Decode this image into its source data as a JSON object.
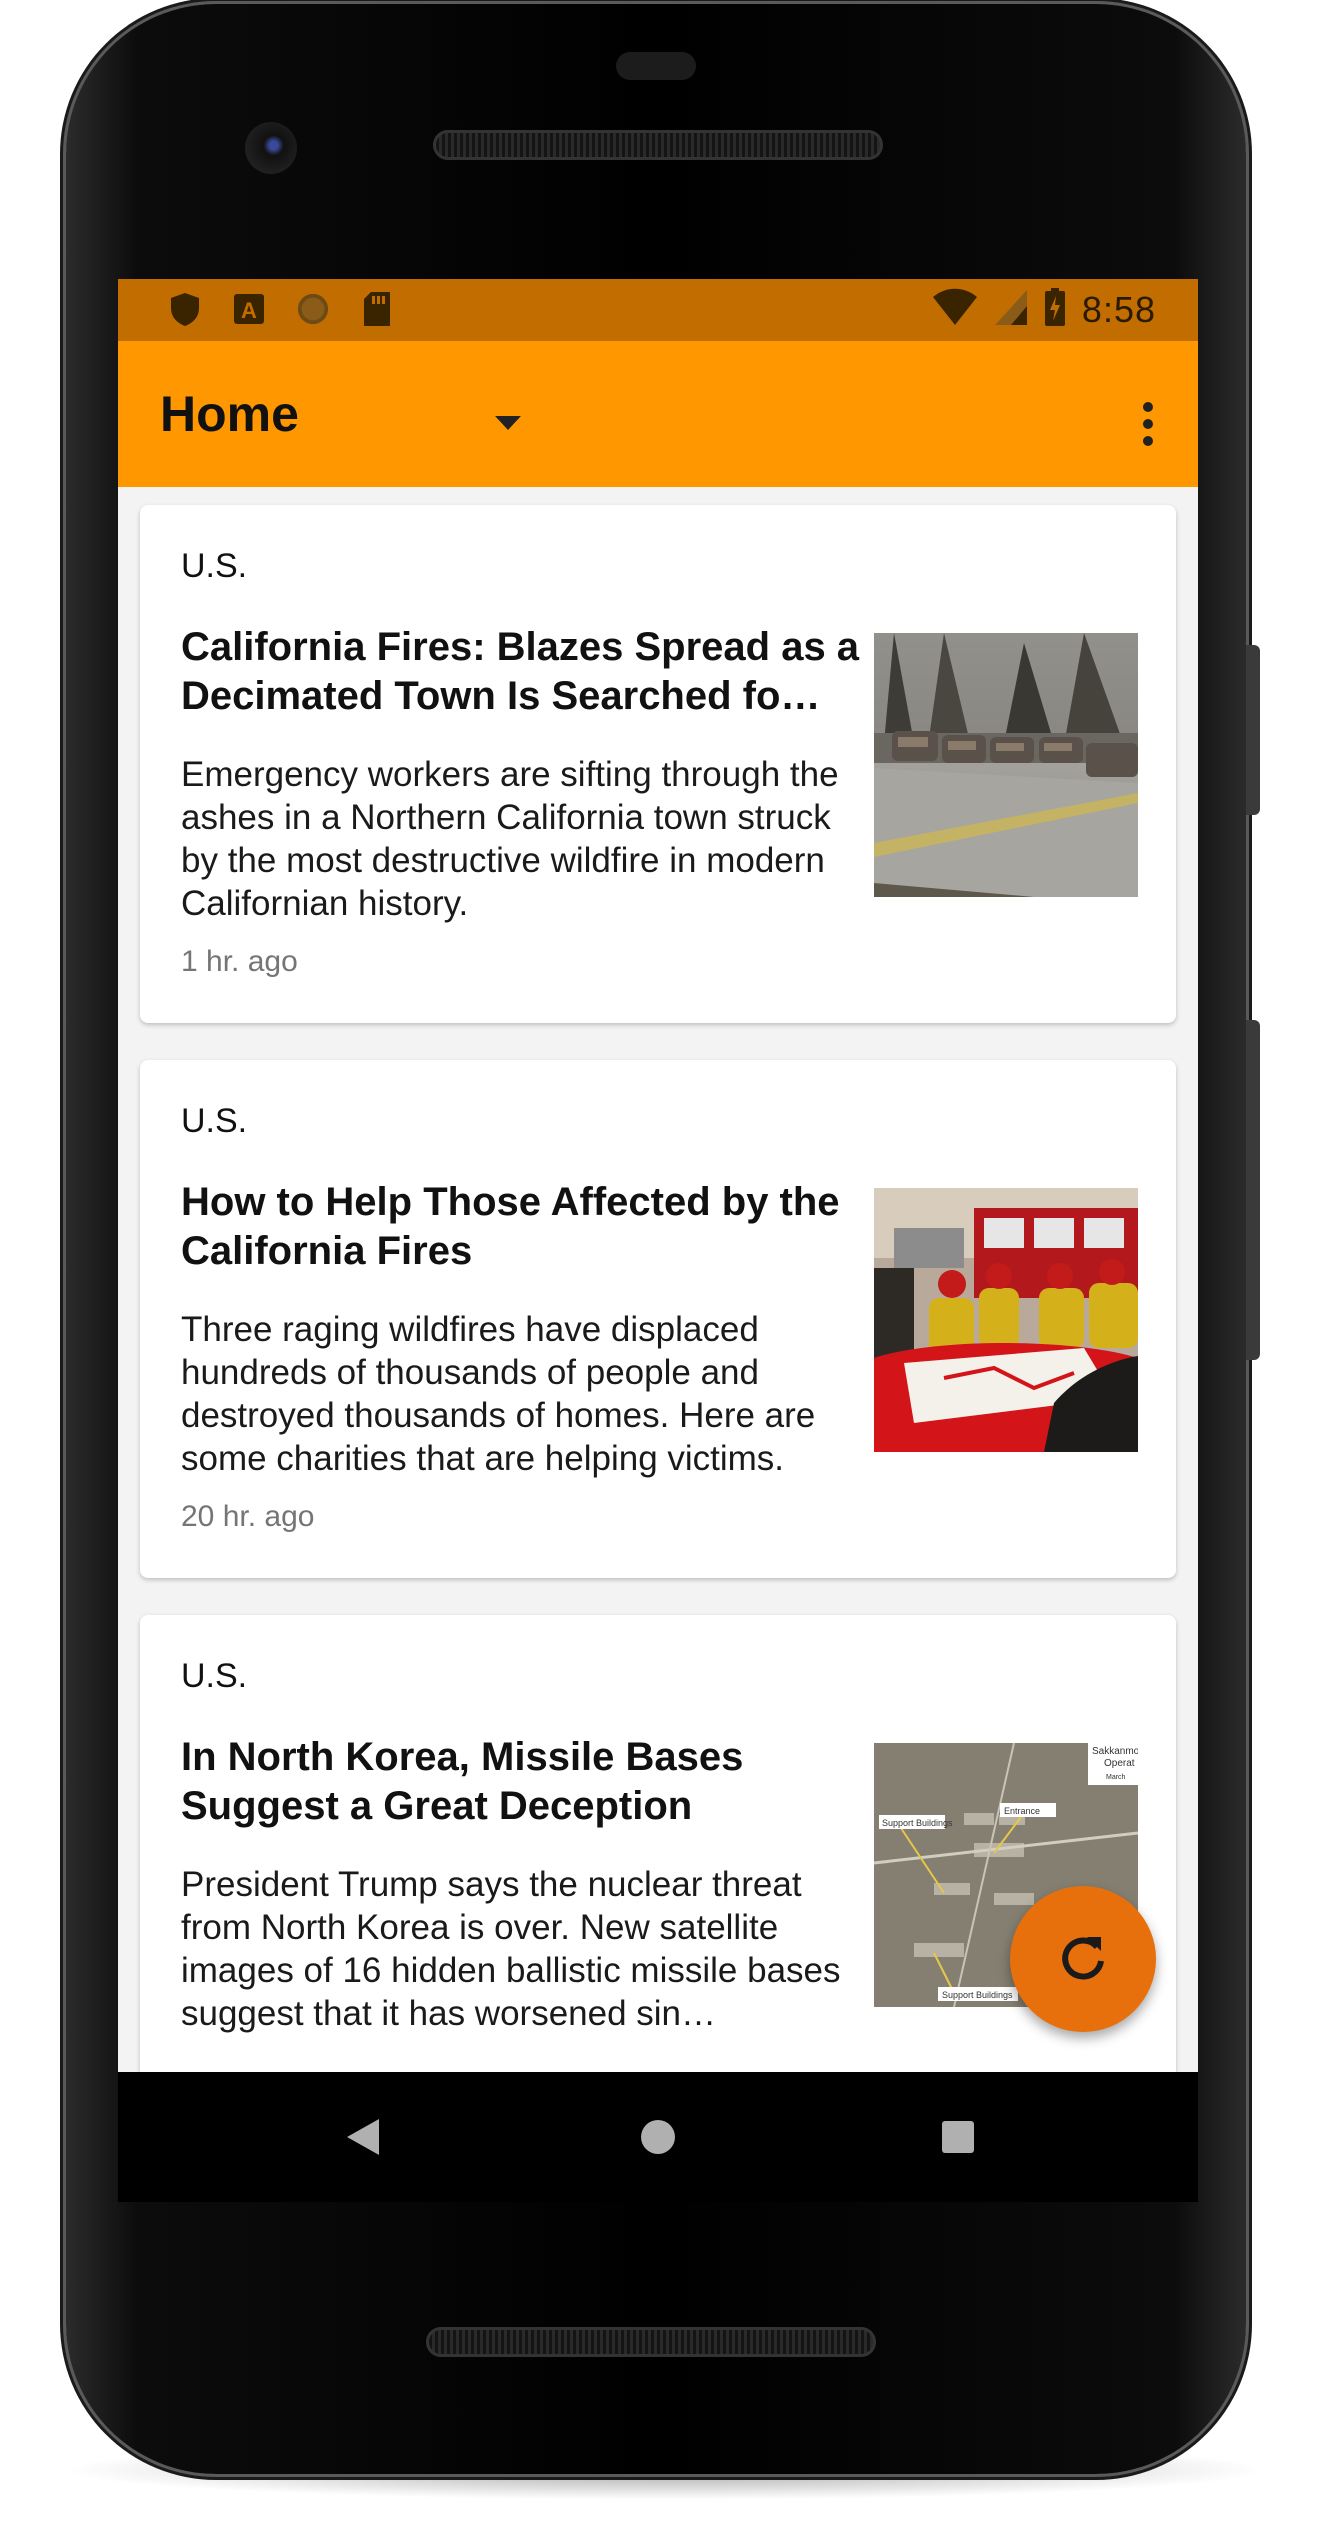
{
  "status_bar": {
    "time": "8:58",
    "left_icons": [
      "shield-icon",
      "font-a-icon",
      "circle-icon",
      "sd-card-icon"
    ],
    "right_icons": [
      "wifi-icon",
      "cell-signal-icon",
      "battery-charging-icon"
    ],
    "background": "#c16d00"
  },
  "app_bar": {
    "title": "Home",
    "background": "#ff9800",
    "icons": [
      "dropdown-arrow-icon",
      "overflow-menu-icon"
    ]
  },
  "articles": [
    {
      "section": "U.S.",
      "title": "California Fires: Blazes Spread as a Decimated Town Is Searched fo…",
      "summary": "Emergency workers are sifting through the ashes in a Northern California town struck by the most destructive wildfire in modern Californian history.",
      "time": "1 hr. ago",
      "thumbnail": "burned-cars-photo"
    },
    {
      "section": "U.S.",
      "title": "How to Help Those Affected by the California Fires",
      "summary": "Three raging wildfires have displaced hundreds of thousands of people and destroyed thousands of homes. Here are some charities that are helping victims.",
      "time": "20 hr. ago",
      "thumbnail": "firefighters-map-photo"
    },
    {
      "section": "U.S.",
      "title": "In North Korea, Missile Bases Suggest a Great Deception",
      "summary": "President Trump says the nuclear threat from North Korea is over. New satellite images of 16 hidden ballistic missile bases suggest that it has worsened sin…",
      "time": "",
      "thumbnail": "satellite-image-photo",
      "thumbnail_labels": [
        "Sakkanmol",
        "Operat",
        "March",
        "Support Buildings",
        "Entrance",
        "Support Buildings"
      ]
    }
  ],
  "fab": {
    "icon": "refresh-icon",
    "color": "#e8700c"
  },
  "nav": {
    "icons": [
      "back-icon",
      "home-icon",
      "recents-icon"
    ]
  }
}
